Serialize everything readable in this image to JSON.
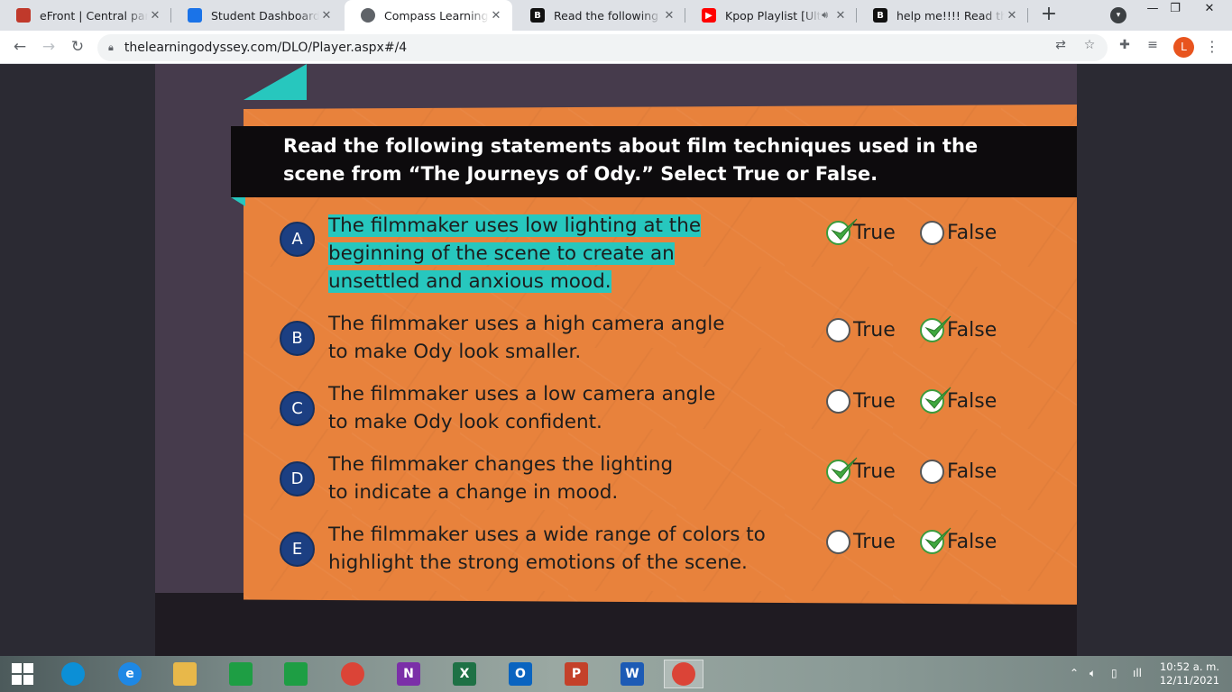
{
  "browser": {
    "tabs": [
      {
        "title": "eFront | Central panel E",
        "favicon": "efront-icon",
        "color": "#c0392b",
        "active": false
      },
      {
        "title": "Student Dashboard - Ti",
        "favicon": "dashboard-icon",
        "color": "#1a73e8",
        "active": false
      },
      {
        "title": "Compass Learning",
        "favicon": "globe-icon",
        "color": "#5f6368",
        "active": true
      },
      {
        "title": "Read the following stat",
        "favicon": "brainly-icon",
        "color": "#111111",
        "active": false
      },
      {
        "title": "Kpop Playlist [Ultim",
        "favicon": "youtube-icon",
        "color": "#ff0000",
        "active": false,
        "audio": true
      },
      {
        "title": "help me!!!! Read the fol",
        "favicon": "brainly-icon",
        "color": "#111111",
        "active": false
      }
    ],
    "new_tab": "+",
    "url": "thelearningodyssey.com/DLO/Player.aspx#/4",
    "profile_initial": "L",
    "profile_color": "#e8541e"
  },
  "quiz": {
    "instruction": "Read the following statements about film techniques used in the scene from “The Journeys of Ody.” Select True or False.",
    "true_label": "True",
    "false_label": "False",
    "statements": [
      {
        "letter": "A",
        "lines": [
          "The filmmaker uses low lighting at the",
          "beginning of the scene to create an",
          "unsettled and anxious mood."
        ],
        "answer": "true",
        "highlighted": true
      },
      {
        "letter": "B",
        "lines": [
          "The filmmaker uses a high camera angle",
          "to make Ody look smaller."
        ],
        "answer": "false",
        "highlighted": false
      },
      {
        "letter": "C",
        "lines": [
          "The filmmaker uses a low camera angle",
          "to make Ody look confident."
        ],
        "answer": "false",
        "highlighted": false
      },
      {
        "letter": "D",
        "lines": [
          "The filmmaker changes the lighting",
          "to indicate a change in mood."
        ],
        "answer": "true",
        "highlighted": false
      },
      {
        "letter": "E",
        "lines": [
          "The filmmaker uses a wide range of colors to",
          "highlight the strong emotions of the scene."
        ],
        "answer": "false",
        "highlighted": false
      }
    ],
    "colors": {
      "card": "#e8823c",
      "highlight": "#27c7be",
      "badge": "#1c3f82",
      "check": "#3fa83f"
    }
  },
  "taskbar": {
    "apps": [
      {
        "name": "start-button",
        "label": "",
        "color": "#ffffff"
      },
      {
        "name": "edge-icon",
        "label": "",
        "color": "#0c8fd6"
      },
      {
        "name": "internet-explorer-icon",
        "label": "e",
        "color": "#1e88e5"
      },
      {
        "name": "file-explorer-icon",
        "label": "",
        "color": "#e8b84a"
      },
      {
        "name": "store-icon",
        "label": "",
        "color": "#1e9e44"
      },
      {
        "name": "calculator-icon",
        "label": "",
        "color": "#1e9e44"
      },
      {
        "name": "chrome-icon",
        "label": "",
        "color": "#db4437"
      },
      {
        "name": "onenote-icon",
        "label": "N",
        "color": "#7b2fa8"
      },
      {
        "name": "excel-icon",
        "label": "X",
        "color": "#1e7145"
      },
      {
        "name": "outlook-icon",
        "label": "O",
        "color": "#0a64c0"
      },
      {
        "name": "powerpoint-icon",
        "label": "P",
        "color": "#c4412a"
      },
      {
        "name": "word-icon",
        "label": "W",
        "color": "#1d5bb5"
      },
      {
        "name": "chrome-profile-icon",
        "label": "",
        "color": "#db4437"
      }
    ],
    "time": "10:52 a. m.",
    "date": "12/11/2021"
  }
}
